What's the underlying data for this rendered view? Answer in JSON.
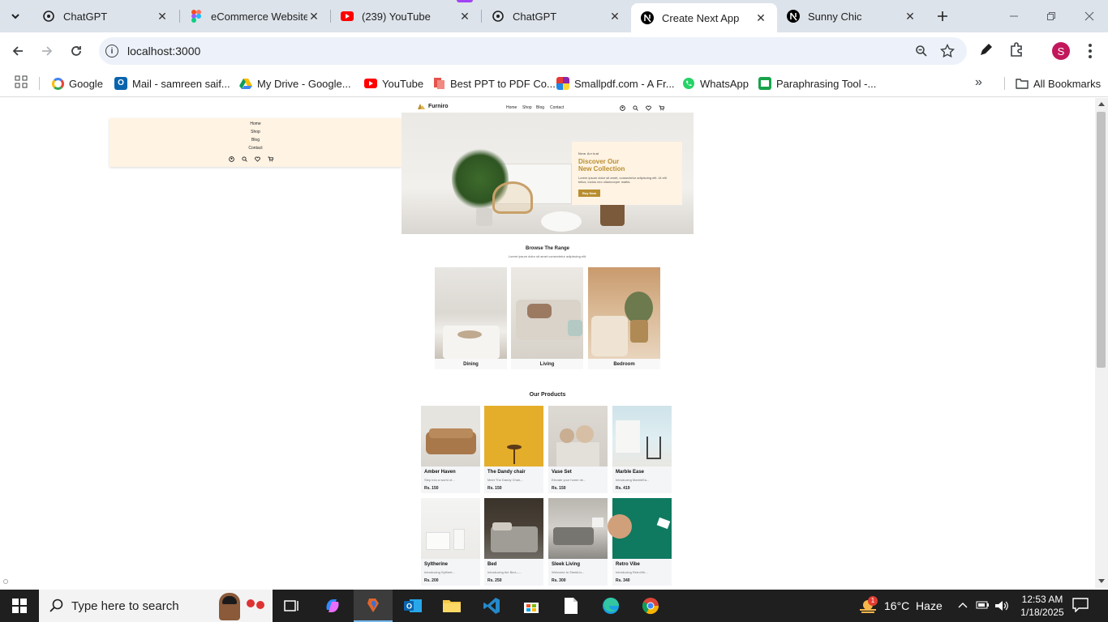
{
  "browser": {
    "tabs": [
      {
        "title": "ChatGPT",
        "icon": "chatgpt-icon"
      },
      {
        "title": "eCommerce Website",
        "icon": "figma-icon"
      },
      {
        "title": "(239) YouTube",
        "icon": "youtube-icon"
      },
      {
        "title": "ChatGPT",
        "icon": "chatgpt-icon"
      },
      {
        "title": "Create Next App",
        "icon": "nextjs-icon",
        "active": true
      },
      {
        "title": "Sunny Chic",
        "icon": "nextjs-icon"
      }
    ],
    "url": "localhost:3000",
    "bookmarks": [
      {
        "label": "Google",
        "icon": "google-icon",
        "color": "#4285f4"
      },
      {
        "label": "Mail - samreen saif...",
        "icon": "outlook-icon",
        "color": "#0a64ad"
      },
      {
        "label": "My Drive - Google...",
        "icon": "drive-icon",
        "color": "#f4b400"
      },
      {
        "label": "YouTube",
        "icon": "youtube-icon",
        "color": "#ff0000"
      },
      {
        "label": "Best PPT to PDF Co...",
        "icon": "pdf-icon",
        "color": "#e5534b"
      },
      {
        "label": "Smallpdf.com - A Fr...",
        "icon": "smallpdf-icon",
        "color": "#8e44ad"
      },
      {
        "label": "WhatsApp",
        "icon": "whatsapp-icon",
        "color": "#25d366"
      },
      {
        "label": "Paraphrasing Tool -...",
        "icon": "quillbot-icon",
        "color": "#17a34a"
      }
    ],
    "all_bookmarks": "All Bookmarks",
    "profile_initial": "S"
  },
  "page": {
    "mobile_menu": {
      "items": [
        "Home",
        "Shop",
        "Blog",
        "Contact"
      ]
    },
    "header": {
      "logo": "Furniro",
      "nav": [
        "Home",
        "Shop",
        "Blog",
        "Contact"
      ]
    },
    "hero": {
      "eyebrow": "New Arrival",
      "title_line1": "Discover Our",
      "title_line2": "New Collection",
      "text": "Lorem ipsum dolor sit amet, consectetur adipiscing elit. Ut elit tellus, luctus nec ullamcorper mattis.",
      "button": "Buy Now"
    },
    "range": {
      "title": "Browse The Range",
      "subtitle": "Lorem ipsum dolor sit amet consectetur adipiscing elit.",
      "categories": [
        "Dining",
        "Living",
        "Bedroom"
      ]
    },
    "products": {
      "title": "Our Products",
      "items": [
        {
          "name": "Amber Haven",
          "desc": "Step into a world of...",
          "price": "Rs. 150"
        },
        {
          "name": "The Dandy chair",
          "desc": "Meet The Dandy Chair,...",
          "price": "Rs. 150"
        },
        {
          "name": "Vase Set",
          "desc": "Elevate your home de...",
          "price": "Rs. 150"
        },
        {
          "name": "Marble Ease",
          "desc": "Introducing MarbleEa...",
          "price": "Rs. 419"
        },
        {
          "name": "Syltherine",
          "desc": "Introducing Sylthert...",
          "price": "Rs. 200"
        },
        {
          "name": "Bed",
          "desc": "Introducing the Bed—...",
          "price": "Rs. 250"
        },
        {
          "name": "Sleek Living",
          "desc": "Welcome to SleekLiv...",
          "price": "Rs. 300"
        },
        {
          "name": "Retro Vibe",
          "desc": "Introducing RetroVib...",
          "price": "Rs. 340"
        }
      ]
    }
  },
  "taskbar": {
    "search_placeholder": "Type here to search",
    "weather": "16°C  Haze",
    "time": "12:53 AM",
    "date": "1/18/2025",
    "notification_count": "1"
  },
  "colors": {
    "accent": "#b88e2f",
    "hero_card": "#fff3e3",
    "mobile_menu_bg": "#fff3e3"
  }
}
